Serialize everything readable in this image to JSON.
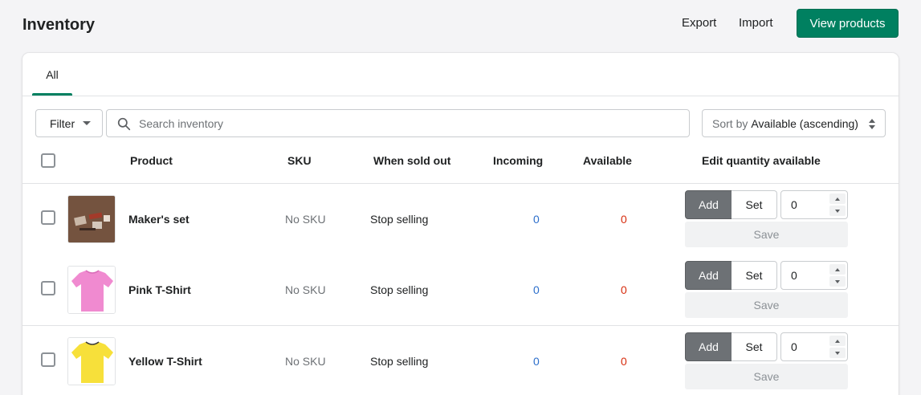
{
  "header": {
    "title": "Inventory",
    "export_label": "Export",
    "import_label": "Import",
    "view_products_label": "View products"
  },
  "tabs": [
    {
      "label": "All",
      "selected": true
    }
  ],
  "toolbar": {
    "filter_label": "Filter",
    "search_placeholder": "Search inventory",
    "sort_label": "Sort by",
    "sort_value": "Available (ascending)"
  },
  "table": {
    "columns": [
      "Product",
      "SKU",
      "When sold out",
      "Incoming",
      "Available",
      "Edit quantity available"
    ],
    "rows": [
      {
        "product": "Maker's set",
        "sku": "No SKU",
        "when_sold_out": "Stop selling",
        "incoming": "0",
        "available": "0",
        "add_label": "Add",
        "set_label": "Set",
        "quantity": "0",
        "save_label": "Save",
        "image": "makers-set"
      },
      {
        "product": "Pink T-Shirt",
        "sku": "No SKU",
        "when_sold_out": "Stop selling",
        "incoming": "0",
        "available": "0",
        "add_label": "Add",
        "set_label": "Set",
        "quantity": "0",
        "save_label": "Save",
        "image": "pink-tshirt"
      },
      {
        "product": "Yellow T-Shirt",
        "sku": "No SKU",
        "when_sold_out": "Stop selling",
        "incoming": "0",
        "available": "0",
        "add_label": "Add",
        "set_label": "Set",
        "quantity": "0",
        "save_label": "Save",
        "image": "yellow-tshirt"
      }
    ]
  },
  "colors": {
    "primary": "#008060",
    "incoming": "#2c6ecb",
    "available": "#d72c0d",
    "segment_active": "#6d7175"
  },
  "icons": [
    "search-icon",
    "caret-down-icon",
    "sort-arrows-icon"
  ]
}
